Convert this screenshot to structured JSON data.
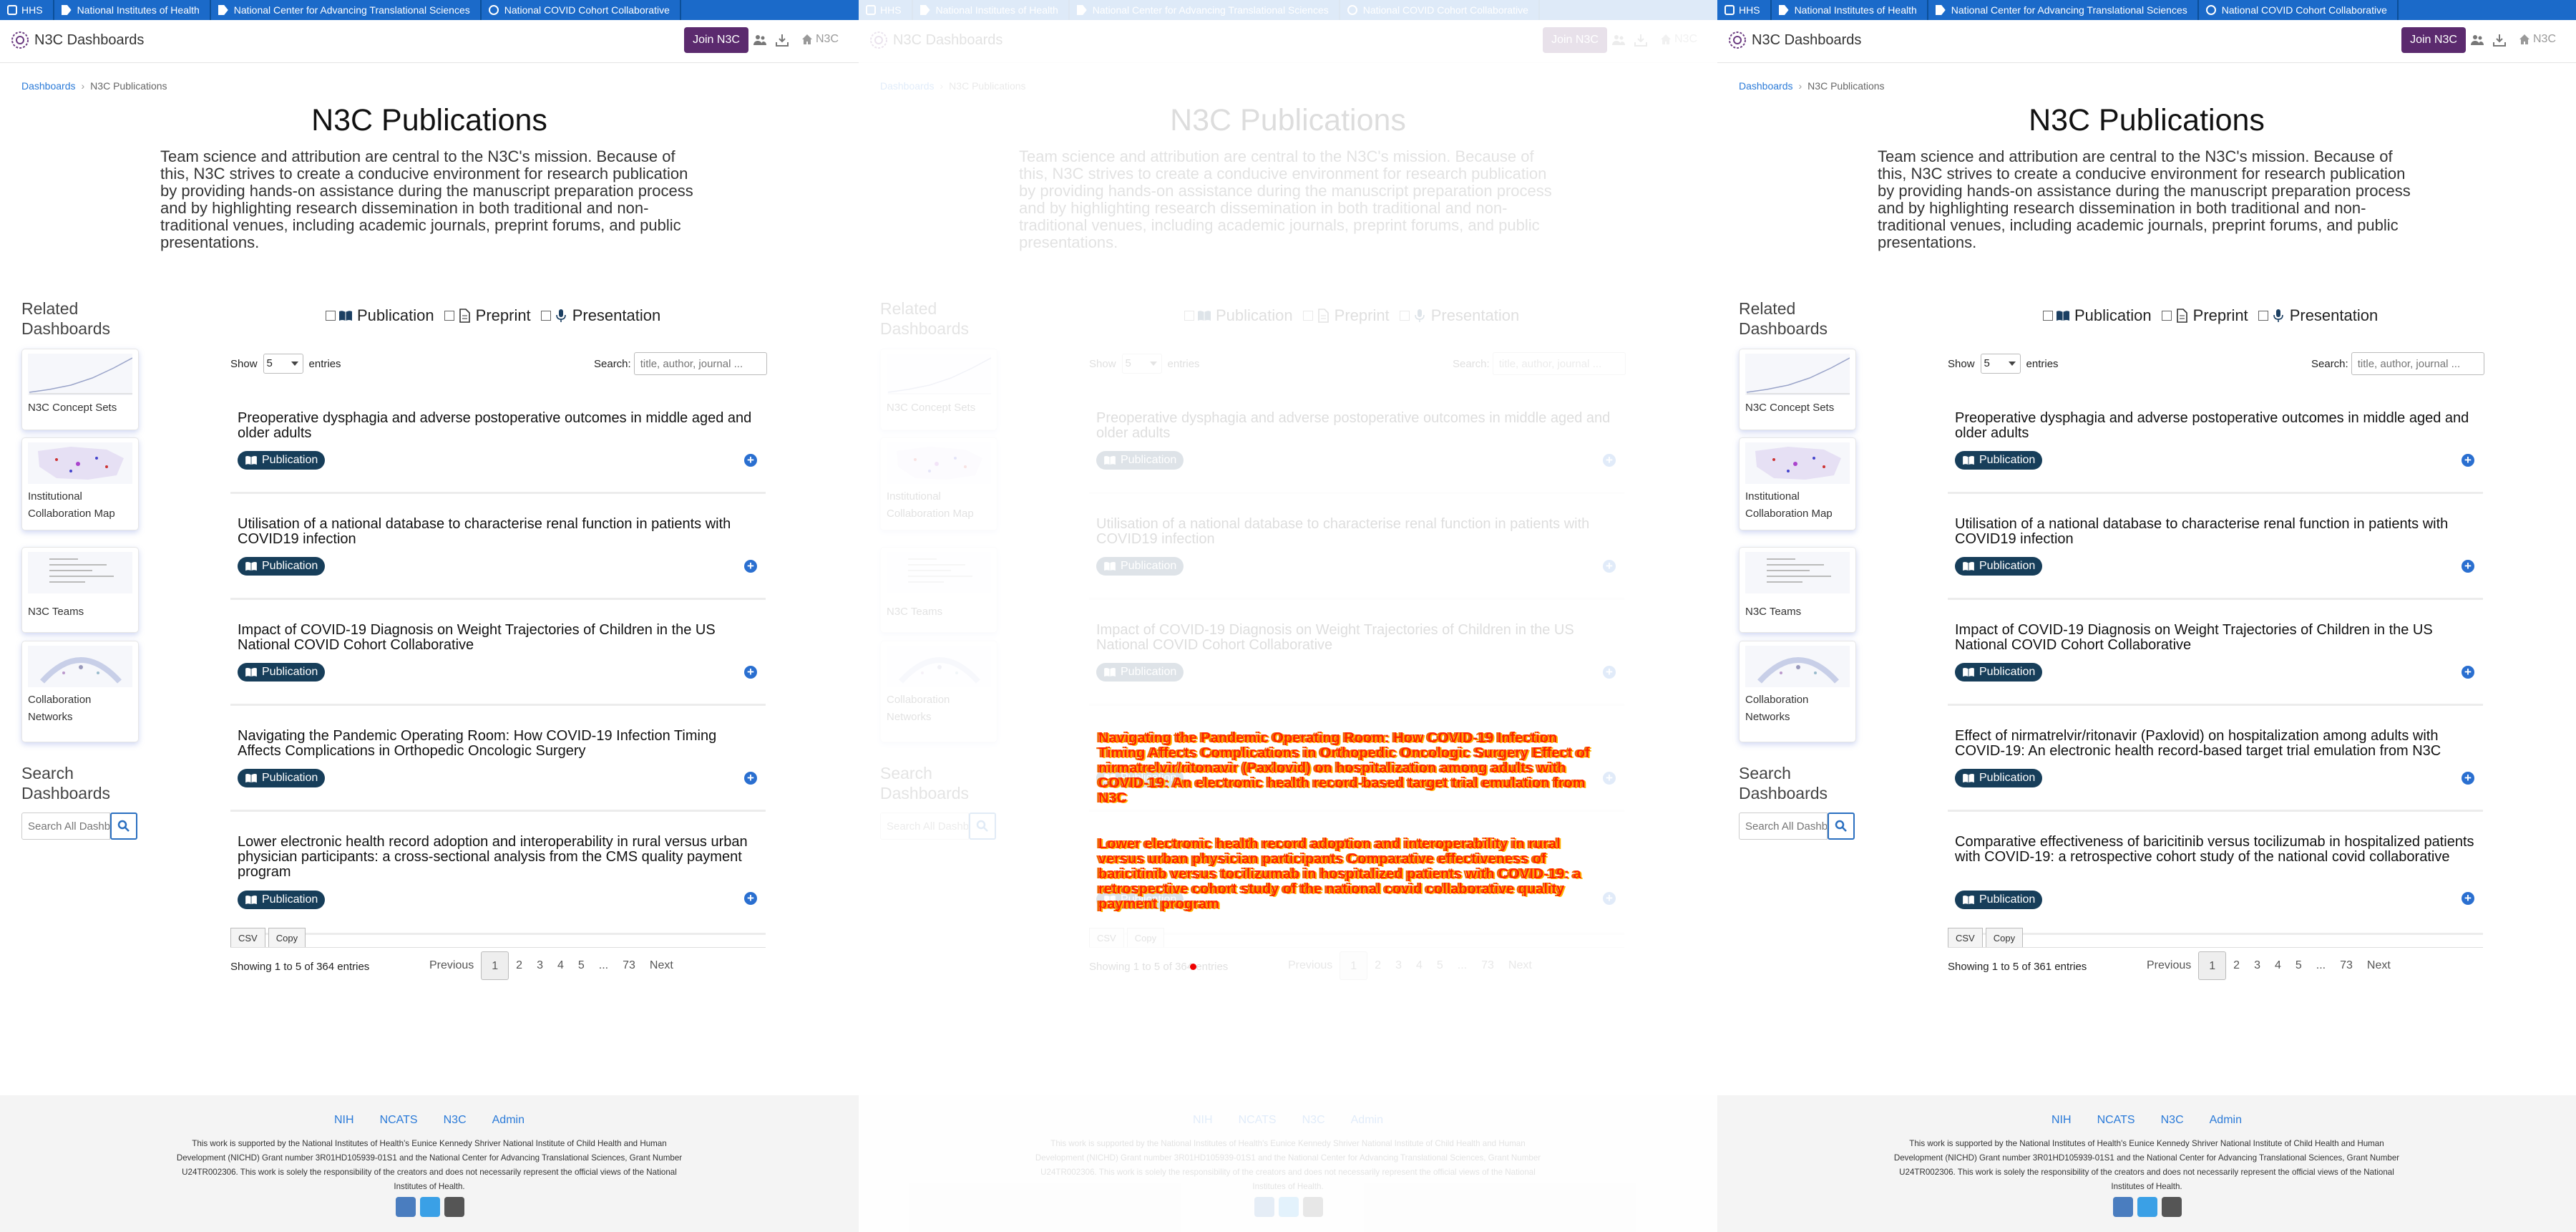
{
  "topbar": {
    "items": [
      "HHS",
      "National Institutes of Health",
      "National Center for Advancing Translational Sciences",
      "National COVID Cohort Collaborative"
    ]
  },
  "navbar": {
    "brand": "N3C Dashboards",
    "join_label": "Join N3C",
    "home_label": "N3C"
  },
  "breadcrumb": {
    "root": "Dashboards",
    "current": "N3C Publications"
  },
  "page": {
    "title": "N3C Publications",
    "intro": "Team science and attribution are central to the N3C's mission. Because of this, N3C strives to create a conducive environment for research publication by providing hands-on assistance during the manuscript preparation process and by highlighting research dissemination in both traditional and non-traditional venues, including academic journals, preprint forums, and public presentations."
  },
  "sidebar": {
    "related_heading": "Related Dashboards",
    "tiles": [
      "N3C Concept Sets",
      "Institutional Collaboration Map",
      "N3C Teams",
      "Collaboration Networks"
    ],
    "search_heading": "Search Dashboards",
    "search_placeholder": "Search All Dashboards"
  },
  "filters": [
    "Publication",
    "Preprint",
    "Presentation"
  ],
  "table": {
    "show_label": "Show",
    "entries_value": "5",
    "entries_label": "entries",
    "search_label": "Search:",
    "search_placeholder": "title, author, journal ...",
    "badge_label": "Publication",
    "csv_label": "CSV",
    "copy_label": "Copy",
    "pager": [
      "Previous",
      "1",
      "2",
      "3",
      "4",
      "5",
      "...",
      "73",
      "Next"
    ]
  },
  "panels": [
    {
      "rows": [
        "Preoperative dysphagia and adverse postoperative outcomes in middle aged and older adults",
        "Utilisation of a national database to characterise renal function in patients with COVID19 infection",
        "Impact of COVID-19 Diagnosis on Weight Trajectories of Children in the US National COVID Cohort Collaborative",
        "Navigating the Pandemic Operating Room: How COVID-19 Infection Timing Affects Complications in Orthopedic Oncologic Surgery",
        "Lower electronic health record adoption and interoperability in rural versus urban physician participants: a cross-sectional analysis from the CMS quality payment program"
      ],
      "info": "Showing 1 to 5 of 364 entries"
    },
    {
      "rows": [
        "Preoperative dysphagia and adverse postoperative outcomes in middle aged and older adults",
        "Utilisation of a national database to characterise renal function in patients with COVID19 infection",
        "Impact of COVID-19 Diagnosis on Weight Trajectories of Children in the US National COVID Cohort Collaborative",
        "",
        ""
      ],
      "info": "Showing 1 to 5 of 364 entries",
      "overlay_1": "Navigating the Pandemic Operating Room: How COVID-19 Infection Timing Affects Complications in Orthopedic Oncologic Surgery Effect of nirmatrelvir/ritonavir (Paxlovid) on hospitalization among adults with COVID-19: An electronic health record-based target trial emulation from N3C",
      "overlay_2": "Lower electronic health record adoption and interoperability in rural versus urban physician participants Comparative effectiveness of baricitinib versus tocilizumab in hospitalized patients with COVID-19: a retrospective cohort study of the national covid collaborative quality payment program"
    },
    {
      "rows": [
        "Preoperative dysphagia and adverse postoperative outcomes in middle aged and older adults",
        "Utilisation of a national database to characterise renal function in patients with COVID19 infection",
        "Impact of COVID-19 Diagnosis on Weight Trajectories of Children in the US National COVID Cohort Collaborative",
        "Effect of nirmatrelvir/ritonavir (Paxlovid) on hospitalization among adults with COVID-19: An electronic health record-based target trial emulation from N3C",
        "Comparative effectiveness of baricitinib versus tocilizumab in hospitalized patients with COVID-19: a retrospective cohort study of the national covid collaborative"
      ],
      "info": "Showing 1 to 5 of 361 entries"
    }
  ],
  "footer": {
    "links": [
      "NIH",
      "NCATS",
      "N3C",
      "Admin"
    ],
    "text": "This work is supported by the National Institutes of Health's Eunice Kennedy Shriver National Institute of Child Health and Human Development (NICHD) Grant number 3R01HD105939-01S1 and the National Center for Advancing Translational Sciences, Grant Number U24TR002306. This work is solely the responsibility of the creators and does not necessarily represent the official views of the National Institutes of Health."
  },
  "colors": {
    "topbar": "#1b6ac9",
    "join": "#5b2a6e",
    "badge": "#173e5a",
    "link": "#2a7ad8"
  }
}
